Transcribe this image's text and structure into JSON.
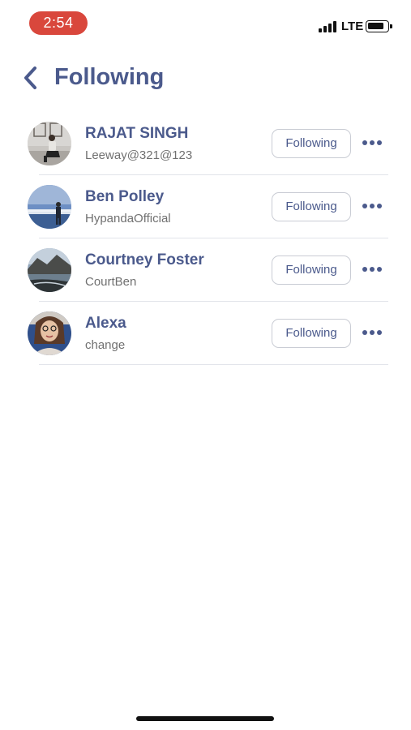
{
  "status_bar": {
    "time": "2:54",
    "network": "LTE",
    "time_pill_color": "#d9473c"
  },
  "header": {
    "title": "Following",
    "back_icon": "chevron-left-icon"
  },
  "accent_color": "#4b5a8c",
  "following": [
    {
      "name": "RAJAT SINGH",
      "handle": "Leeway@321@123",
      "button_label": "Following",
      "more_icon": "more-horizontal-icon"
    },
    {
      "name": "Ben Polley",
      "handle": "HypandaOfficial",
      "button_label": "Following",
      "more_icon": "more-horizontal-icon"
    },
    {
      "name": "Courtney Foster",
      "handle": "CourtBen",
      "button_label": "Following",
      "more_icon": "more-horizontal-icon"
    },
    {
      "name": "Alexa",
      "handle": "change",
      "button_label": "Following",
      "more_icon": "more-horizontal-icon"
    }
  ]
}
